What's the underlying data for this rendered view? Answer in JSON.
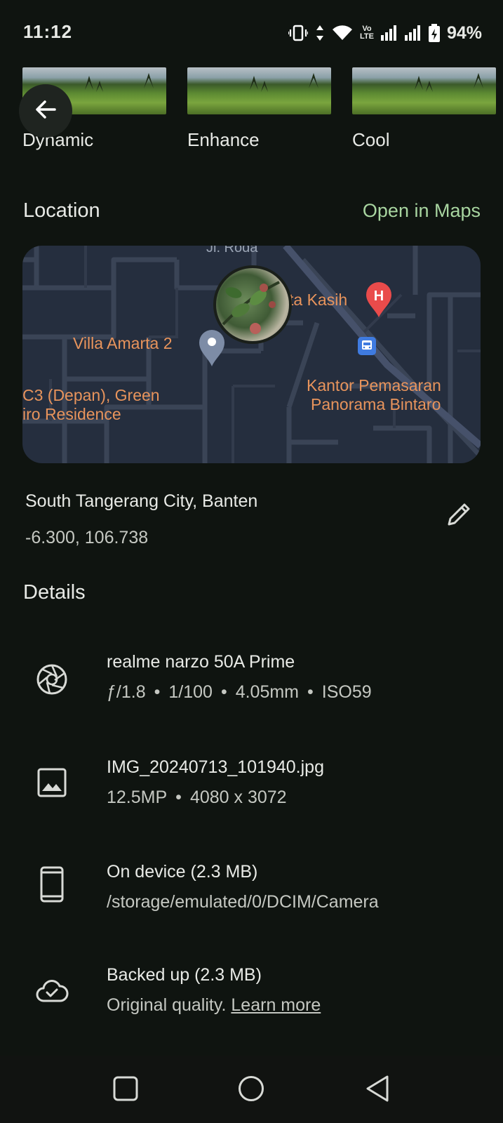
{
  "status": {
    "time": "11:12",
    "battery": "94%",
    "volte": "Vo\nLTE"
  },
  "filters": [
    {
      "label": "Dynamic"
    },
    {
      "label": "Enhance"
    },
    {
      "label": "Cool"
    }
  ],
  "location": {
    "title": "Location",
    "open_maps": "Open in Maps",
    "map_labels": {
      "road": "Jl. Roda",
      "hospital": "ta Kasih",
      "villa": "Villa Amarta 2",
      "residence_1": "C3 (Depan), Green",
      "residence_2": "iro Residence",
      "office_1": "Kantor Pemasaran",
      "office_2": "Panorama Bintaro"
    },
    "place": "South Tangerang City, Banten",
    "coords": "-6.300, 106.738"
  },
  "details": {
    "title": "Details",
    "camera": {
      "model": "realme narzo 50A Prime",
      "aperture": "ƒ/1.8",
      "shutter": "1/100",
      "focal": "4.05mm",
      "iso": "ISO59",
      "sep": "•"
    },
    "file": {
      "name": "IMG_20240713_101940.jpg",
      "megapixels": "12.5MP",
      "resolution": "4080 x 3072",
      "sep": "•"
    },
    "storage": {
      "title": "On device (2.3 MB)",
      "path": "/storage/emulated/0/DCIM/Camera"
    },
    "backup": {
      "title": "Backed up (2.3 MB)",
      "quality": "Original quality.",
      "learn_more": "Learn more"
    }
  },
  "colors": {
    "background": "#0f1410",
    "accent_link": "#a8d5a0",
    "map_background": "#252e3e",
    "map_label": "#e8945c",
    "hospital_pin": "#e94b4b"
  },
  "icons": {
    "back": "arrow-left-icon",
    "edit": "pencil-icon",
    "camera": "aperture-icon",
    "file": "image-icon",
    "storage": "phone-icon",
    "backup": "cloud-check-icon",
    "nav_recents": "square-icon",
    "nav_home": "circle-icon",
    "nav_back": "triangle-back-icon"
  }
}
